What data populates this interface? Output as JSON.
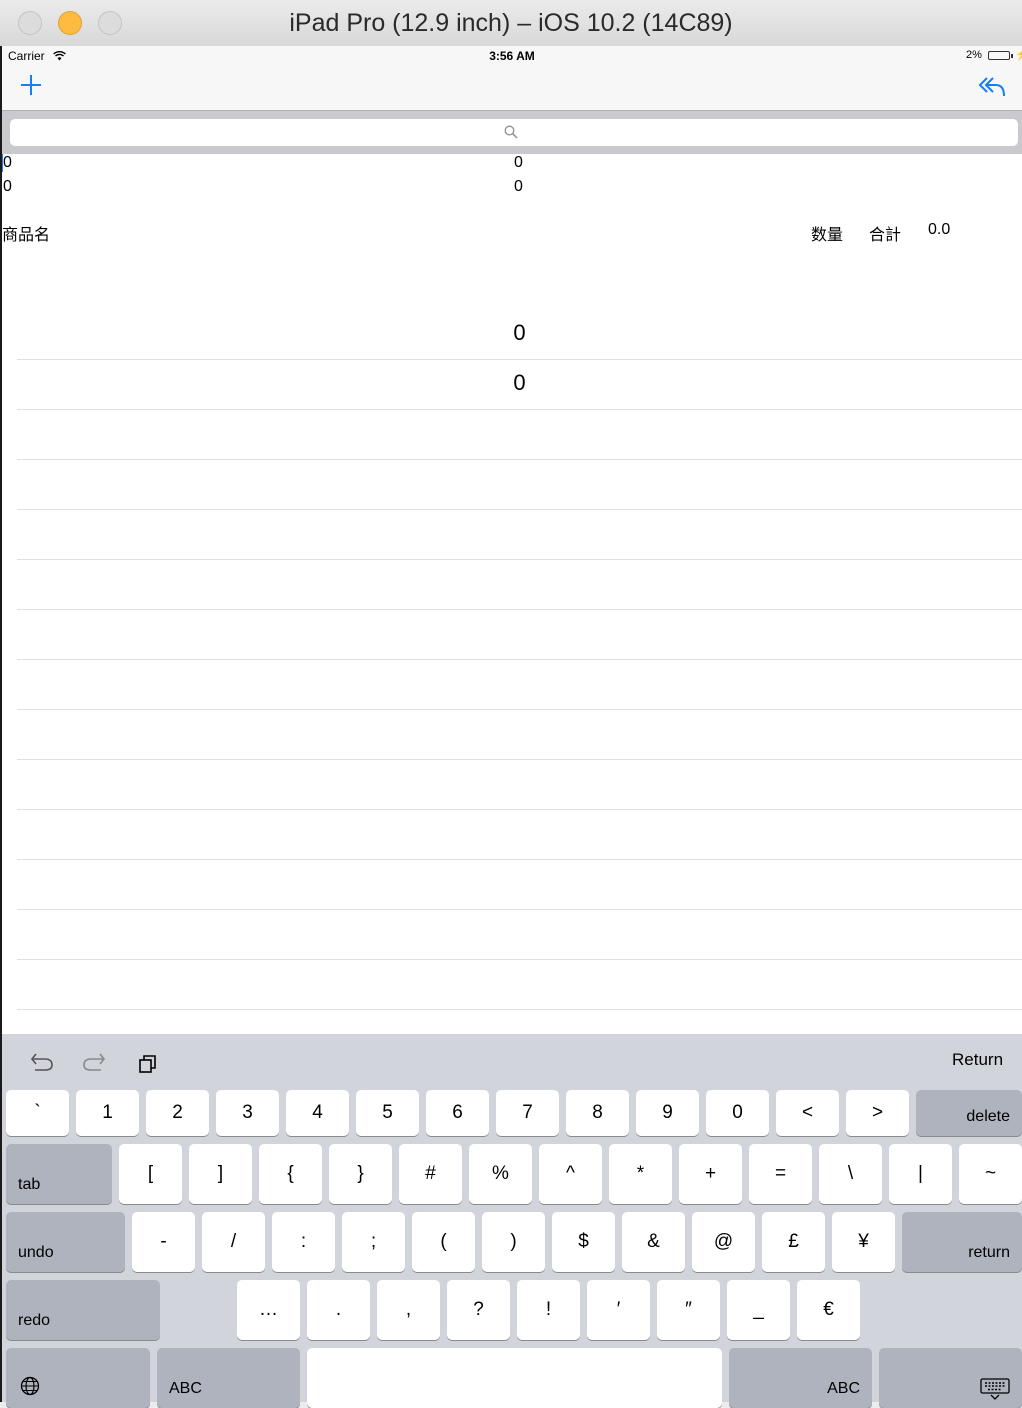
{
  "window": {
    "title": "iPad Pro (12.9 inch) – iOS 10.2 (14C89)"
  },
  "status_bar": {
    "carrier": "Carrier",
    "time": "3:56 AM",
    "battery": "2%"
  },
  "navbar": {
    "add_icon": "plus-icon",
    "reply_icon": "reply-icon"
  },
  "search": {
    "placeholder": "",
    "icon": "search-icon"
  },
  "top_values": [
    {
      "left": "0",
      "right": "0"
    },
    {
      "left": "0",
      "right": "0"
    }
  ],
  "header": {
    "name": "商品名",
    "quantity": "数量",
    "total": "合計",
    "total_value": "0.0"
  },
  "rows": [
    "0",
    "0",
    "",
    "",
    "",
    "",
    "",
    "",
    "",
    "",
    "",
    "",
    "",
    ""
  ],
  "keyboard": {
    "shortcut_return": "Return",
    "row1": [
      "`",
      "1",
      "2",
      "3",
      "4",
      "5",
      "6",
      "7",
      "8",
      "9",
      "0",
      "<",
      ">"
    ],
    "delete": "delete",
    "tab": "tab",
    "row2": [
      "[",
      "]",
      "{",
      "}",
      "#",
      "%",
      "^",
      "*",
      "+",
      "=",
      "\\",
      "|",
      "~"
    ],
    "undo": "undo",
    "row3": [
      "-",
      "/",
      ":",
      ";",
      "(",
      ")",
      "$",
      "&",
      "@",
      "£",
      "¥"
    ],
    "return": "return",
    "redo": "redo",
    "row4": [
      "…",
      ".",
      ",",
      "?",
      "!",
      "′",
      "″",
      "_",
      "€"
    ],
    "abc_left": "ABC",
    "abc_right": "ABC"
  }
}
